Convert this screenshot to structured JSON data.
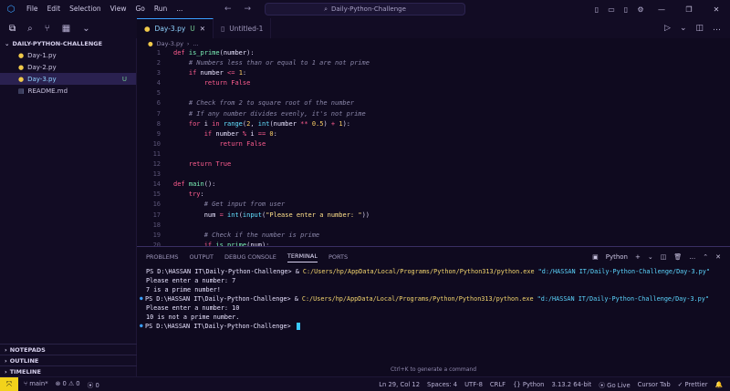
{
  "titlebar": {
    "menu": [
      "File",
      "Edit",
      "Selection",
      "View",
      "Go",
      "Run",
      "..."
    ],
    "search_text": "Daily-Python-Challenge"
  },
  "sidebar": {
    "title": "DAILY-PYTHON-CHALLENGE",
    "files": [
      {
        "name": "Day-1.py",
        "status": ""
      },
      {
        "name": "Day-2.py",
        "status": ""
      },
      {
        "name": "Day-3.py",
        "status": "U"
      },
      {
        "name": "README.md",
        "status": ""
      }
    ],
    "sections": [
      "NOTEPADS",
      "OUTLINE",
      "TIMELINE"
    ]
  },
  "tabs": [
    {
      "label": "Day-3.py",
      "status": "U",
      "active": true
    },
    {
      "label": "Untitled-1",
      "active": false
    }
  ],
  "breadcrumb": {
    "file": "Day-3.py",
    "symbol": "..."
  },
  "code": [
    {
      "n": "1",
      "h": "<span class='k'>def</span> <span class='fn'>is_prime</span>(<span class='v'>number</span>):"
    },
    {
      "n": "2",
      "h": "    <span class='c'># Numbers less than or equal to 1 are not prime</span>"
    },
    {
      "n": "3",
      "h": "    <span class='k'>if</span> <span class='v'>number</span> <span class='k'>&lt;=</span> <span class='n'>1</span>:"
    },
    {
      "n": "4",
      "h": "        <span class='k'>return</span> <span class='k'>False</span>"
    },
    {
      "n": "5",
      "h": ""
    },
    {
      "n": "6",
      "h": "    <span class='c'># Check from 2 to square root of the number</span>"
    },
    {
      "n": "7",
      "h": "    <span class='c'># If any number divides evenly, it's not prime</span>"
    },
    {
      "n": "8",
      "h": "    <span class='k'>for</span> <span class='v'>i</span> <span class='k'>in</span> <span class='b'>range</span>(<span class='n'>2</span>, <span class='b'>int</span>(<span class='v'>number</span> <span class='k'>**</span> <span class='n'>0.5</span>) <span class='k'>+</span> <span class='n'>1</span>):"
    },
    {
      "n": "9",
      "h": "        <span class='k'>if</span> <span class='v'>number</span> <span class='k'>%</span> <span class='v'>i</span> <span class='k'>==</span> <span class='n'>0</span>:"
    },
    {
      "n": "10",
      "h": "            <span class='k'>return</span> <span class='k'>False</span>"
    },
    {
      "n": "11",
      "h": ""
    },
    {
      "n": "12",
      "h": "    <span class='k'>return</span> <span class='k'>True</span>"
    },
    {
      "n": "13",
      "h": ""
    },
    {
      "n": "14",
      "h": "<span class='k'>def</span> <span class='fn'>main</span>():"
    },
    {
      "n": "15",
      "h": "    <span class='k'>try</span>:"
    },
    {
      "n": "16",
      "h": "        <span class='c'># Get input from user</span>"
    },
    {
      "n": "17",
      "h": "        <span class='v'>num</span> <span class='k'>=</span> <span class='b'>int</span>(<span class='b'>input</span>(<span class='s'>\"Please enter a number: \"</span>))"
    },
    {
      "n": "18",
      "h": ""
    },
    {
      "n": "19",
      "h": "        <span class='c'># Check if the number is prime</span>"
    },
    {
      "n": "20",
      "h": "        <span class='k'>if</span> <span class='fn'>is_prime</span>(<span class='v'>num</span>):"
    }
  ],
  "panel": {
    "tabs": [
      "PROBLEMS",
      "OUTPUT",
      "DEBUG CONSOLE",
      "TERMINAL",
      "PORTS"
    ],
    "active_tab": "TERMINAL",
    "shell": "Python",
    "terminal": [
      {
        "dot": false,
        "prompt": "PS D:\\HASSAN IT\\Daily-Python-Challenge> ",
        "amp": "& ",
        "cmd": "C:/Users/hp/AppData/Local/Programs/Python/Python313/python.exe",
        "path": " \"d:/HASSAN IT/Daily-Python-Challenge/Day-3.py\""
      },
      {
        "text": "Please enter a number: 7"
      },
      {
        "text": "7 is a prime number!"
      },
      {
        "dot": true,
        "prompt": "PS D:\\HASSAN IT\\Daily-Python-Challenge> ",
        "amp": "& ",
        "cmd": "C:/Users/hp/AppData/Local/Programs/Python/Python313/python.exe",
        "path": " \"d:/HASSAN IT/Daily-Python-Challenge/Day-3.py\""
      },
      {
        "text": "Please enter a number: 10"
      },
      {
        "text": "10 is not a prime number."
      },
      {
        "dot": true,
        "prompt": "PS D:\\HASSAN IT\\Daily-Python-Challenge> ",
        "cursor": true
      }
    ],
    "hint": "Ctrl+K to generate a command"
  },
  "statusbar": {
    "branch": "main*",
    "errors": "0",
    "warnings": "0",
    "ports": "0",
    "position": "Ln 29, Col 12",
    "spaces": "Spaces: 4",
    "encoding": "UTF-8",
    "eol": "CRLF",
    "language": "Python",
    "interpreter": "3.13.2 64-bit",
    "golive": "Go Live",
    "cursortab": "Cursor Tab",
    "prettier": "Prettier"
  }
}
